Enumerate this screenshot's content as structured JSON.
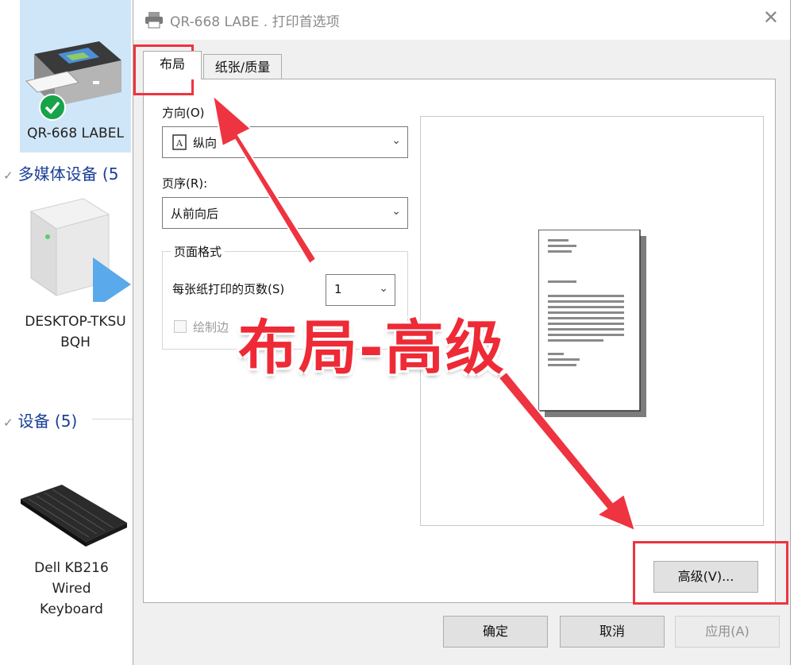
{
  "background": {
    "devices": [
      {
        "label": "QR-668 LABEL",
        "status": "default-check-icon"
      },
      {
        "label_lines": [
          "DESKTOP-TKSU",
          "BQH"
        ]
      },
      {
        "label_lines": [
          "Dell KB216",
          "Wired",
          "Keyboard"
        ]
      }
    ],
    "groups": {
      "multimedia": "多媒体设备 (5",
      "devices": "设备 (5)"
    }
  },
  "dialog": {
    "title": "QR-668 LABE . 打印首选项",
    "tabs": [
      "布局",
      "纸张/质量"
    ],
    "orientation_label": "方向(O)",
    "orientation_value": "纵向",
    "page_order_label": "页序(R):",
    "page_order_value": "从前向后",
    "page_format_group": "页面格式",
    "pages_per_sheet_label": "每张纸打印的页数(S)",
    "pages_per_sheet_value": "1",
    "draw_borders_label": "绘制边",
    "buttons": {
      "advanced": "高级(V)...",
      "ok": "确定",
      "cancel": "取消",
      "apply": "应用(A)"
    }
  },
  "annotation": {
    "caption": "布局-高级",
    "color": "#ee3440"
  }
}
